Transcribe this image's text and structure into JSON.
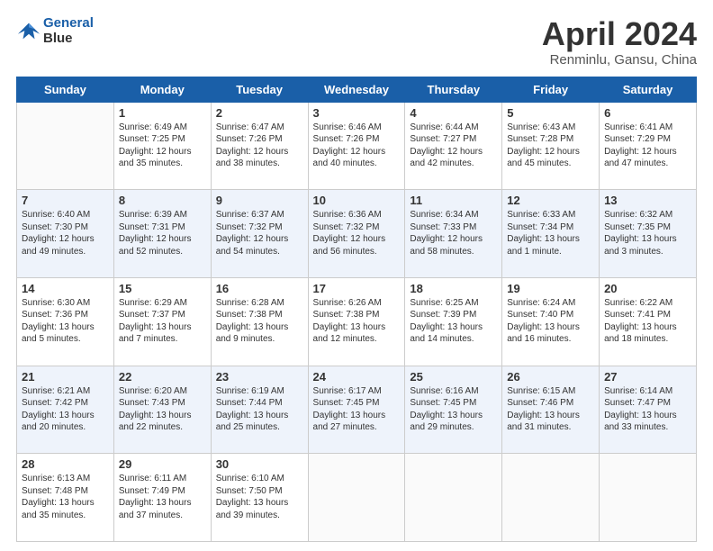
{
  "header": {
    "logo_line1": "General",
    "logo_line2": "Blue",
    "month": "April 2024",
    "location": "Renminlu, Gansu, China"
  },
  "weekdays": [
    "Sunday",
    "Monday",
    "Tuesday",
    "Wednesday",
    "Thursday",
    "Friday",
    "Saturday"
  ],
  "weeks": [
    [
      {
        "day": "",
        "info": ""
      },
      {
        "day": "1",
        "info": "Sunrise: 6:49 AM\nSunset: 7:25 PM\nDaylight: 12 hours\nand 35 minutes."
      },
      {
        "day": "2",
        "info": "Sunrise: 6:47 AM\nSunset: 7:26 PM\nDaylight: 12 hours\nand 38 minutes."
      },
      {
        "day": "3",
        "info": "Sunrise: 6:46 AM\nSunset: 7:26 PM\nDaylight: 12 hours\nand 40 minutes."
      },
      {
        "day": "4",
        "info": "Sunrise: 6:44 AM\nSunset: 7:27 PM\nDaylight: 12 hours\nand 42 minutes."
      },
      {
        "day": "5",
        "info": "Sunrise: 6:43 AM\nSunset: 7:28 PM\nDaylight: 12 hours\nand 45 minutes."
      },
      {
        "day": "6",
        "info": "Sunrise: 6:41 AM\nSunset: 7:29 PM\nDaylight: 12 hours\nand 47 minutes."
      }
    ],
    [
      {
        "day": "7",
        "info": "Sunrise: 6:40 AM\nSunset: 7:30 PM\nDaylight: 12 hours\nand 49 minutes."
      },
      {
        "day": "8",
        "info": "Sunrise: 6:39 AM\nSunset: 7:31 PM\nDaylight: 12 hours\nand 52 minutes."
      },
      {
        "day": "9",
        "info": "Sunrise: 6:37 AM\nSunset: 7:32 PM\nDaylight: 12 hours\nand 54 minutes."
      },
      {
        "day": "10",
        "info": "Sunrise: 6:36 AM\nSunset: 7:32 PM\nDaylight: 12 hours\nand 56 minutes."
      },
      {
        "day": "11",
        "info": "Sunrise: 6:34 AM\nSunset: 7:33 PM\nDaylight: 12 hours\nand 58 minutes."
      },
      {
        "day": "12",
        "info": "Sunrise: 6:33 AM\nSunset: 7:34 PM\nDaylight: 13 hours\nand 1 minute."
      },
      {
        "day": "13",
        "info": "Sunrise: 6:32 AM\nSunset: 7:35 PM\nDaylight: 13 hours\nand 3 minutes."
      }
    ],
    [
      {
        "day": "14",
        "info": "Sunrise: 6:30 AM\nSunset: 7:36 PM\nDaylight: 13 hours\nand 5 minutes."
      },
      {
        "day": "15",
        "info": "Sunrise: 6:29 AM\nSunset: 7:37 PM\nDaylight: 13 hours\nand 7 minutes."
      },
      {
        "day": "16",
        "info": "Sunrise: 6:28 AM\nSunset: 7:38 PM\nDaylight: 13 hours\nand 9 minutes."
      },
      {
        "day": "17",
        "info": "Sunrise: 6:26 AM\nSunset: 7:38 PM\nDaylight: 13 hours\nand 12 minutes."
      },
      {
        "day": "18",
        "info": "Sunrise: 6:25 AM\nSunset: 7:39 PM\nDaylight: 13 hours\nand 14 minutes."
      },
      {
        "day": "19",
        "info": "Sunrise: 6:24 AM\nSunset: 7:40 PM\nDaylight: 13 hours\nand 16 minutes."
      },
      {
        "day": "20",
        "info": "Sunrise: 6:22 AM\nSunset: 7:41 PM\nDaylight: 13 hours\nand 18 minutes."
      }
    ],
    [
      {
        "day": "21",
        "info": "Sunrise: 6:21 AM\nSunset: 7:42 PM\nDaylight: 13 hours\nand 20 minutes."
      },
      {
        "day": "22",
        "info": "Sunrise: 6:20 AM\nSunset: 7:43 PM\nDaylight: 13 hours\nand 22 minutes."
      },
      {
        "day": "23",
        "info": "Sunrise: 6:19 AM\nSunset: 7:44 PM\nDaylight: 13 hours\nand 25 minutes."
      },
      {
        "day": "24",
        "info": "Sunrise: 6:17 AM\nSunset: 7:45 PM\nDaylight: 13 hours\nand 27 minutes."
      },
      {
        "day": "25",
        "info": "Sunrise: 6:16 AM\nSunset: 7:45 PM\nDaylight: 13 hours\nand 29 minutes."
      },
      {
        "day": "26",
        "info": "Sunrise: 6:15 AM\nSunset: 7:46 PM\nDaylight: 13 hours\nand 31 minutes."
      },
      {
        "day": "27",
        "info": "Sunrise: 6:14 AM\nSunset: 7:47 PM\nDaylight: 13 hours\nand 33 minutes."
      }
    ],
    [
      {
        "day": "28",
        "info": "Sunrise: 6:13 AM\nSunset: 7:48 PM\nDaylight: 13 hours\nand 35 minutes."
      },
      {
        "day": "29",
        "info": "Sunrise: 6:11 AM\nSunset: 7:49 PM\nDaylight: 13 hours\nand 37 minutes."
      },
      {
        "day": "30",
        "info": "Sunrise: 6:10 AM\nSunset: 7:50 PM\nDaylight: 13 hours\nand 39 minutes."
      },
      {
        "day": "",
        "info": ""
      },
      {
        "day": "",
        "info": ""
      },
      {
        "day": "",
        "info": ""
      },
      {
        "day": "",
        "info": ""
      }
    ]
  ]
}
